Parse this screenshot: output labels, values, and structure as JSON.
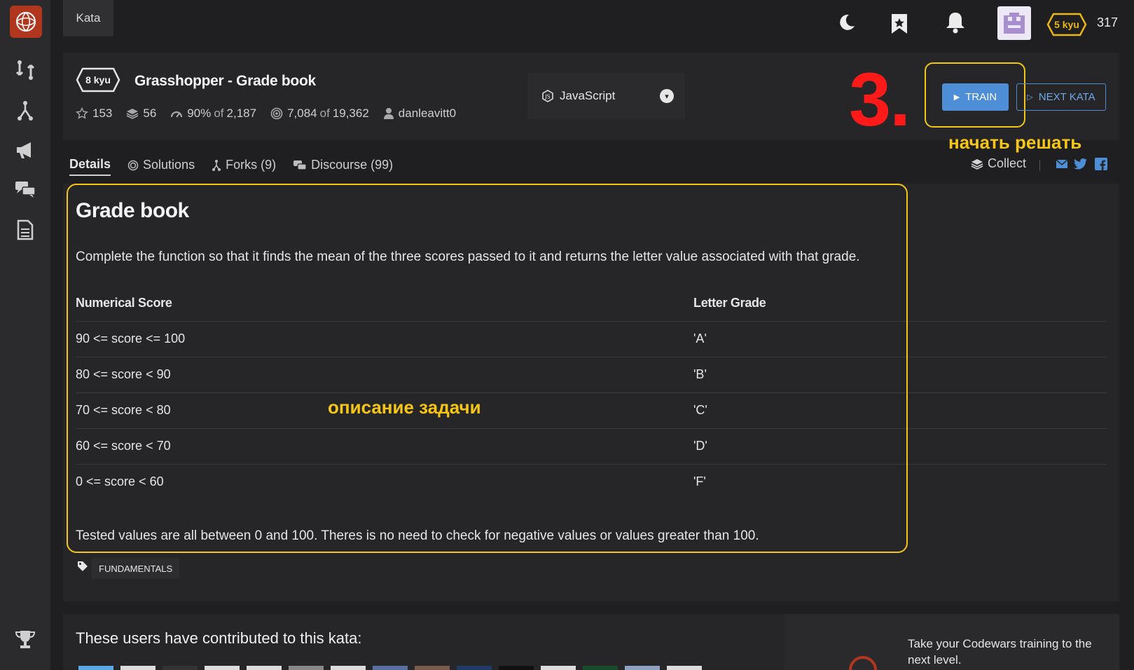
{
  "topbar": {
    "kata_tab": "Kata",
    "rank": "5 kyu",
    "honor": "317"
  },
  "kata": {
    "kyu": "8 kyu",
    "title": "Grasshopper - Grade book",
    "stars": "153",
    "collections": "56",
    "satisfaction": "90%",
    "satisfaction_of": "of",
    "votes": "2,187",
    "completed": "7,084",
    "completed_of": "of",
    "attempted": "19,362",
    "author": "danleavitt0"
  },
  "language": {
    "selected": "JavaScript"
  },
  "actions": {
    "train": "TRAIN",
    "next_kata": "NEXT KATA"
  },
  "annotations": {
    "step": "3.",
    "train_hint": "начать решать",
    "desc_hint": "описание задачи"
  },
  "tabs": {
    "details": "Details",
    "solutions": "Solutions",
    "forks": "Forks (9)",
    "discourse": "Discourse (99)"
  },
  "collect": "Collect",
  "description": {
    "title": "Grade book",
    "intro": "Complete the function so that it finds the mean of the three scores passed to it and returns the letter value associated with that grade.",
    "table": {
      "headers": [
        "Numerical Score",
        "Letter Grade"
      ],
      "rows": [
        [
          "90 <= score <= 100",
          "'A'"
        ],
        [
          "80 <= score < 90",
          "'B'"
        ],
        [
          "70 <= score < 80",
          "'C'"
        ],
        [
          "60 <= score < 70",
          "'D'"
        ],
        [
          "0 <= score < 60",
          "'F'"
        ]
      ]
    },
    "footer": "Tested values are all between 0 and 100. Theres is no need to check for negative values or values greater than 100."
  },
  "tags": [
    "FUNDAMENTALS"
  ],
  "contributors": {
    "title": "These users have contributed to this kata:"
  },
  "promo": {
    "text": "Take your Codewars training to the next level."
  },
  "colors": {
    "accent_blue": "#4d8ed6",
    "annotation_yellow": "#f5c518",
    "annotation_red": "#ff1a1a",
    "brand": "#b1361e"
  }
}
